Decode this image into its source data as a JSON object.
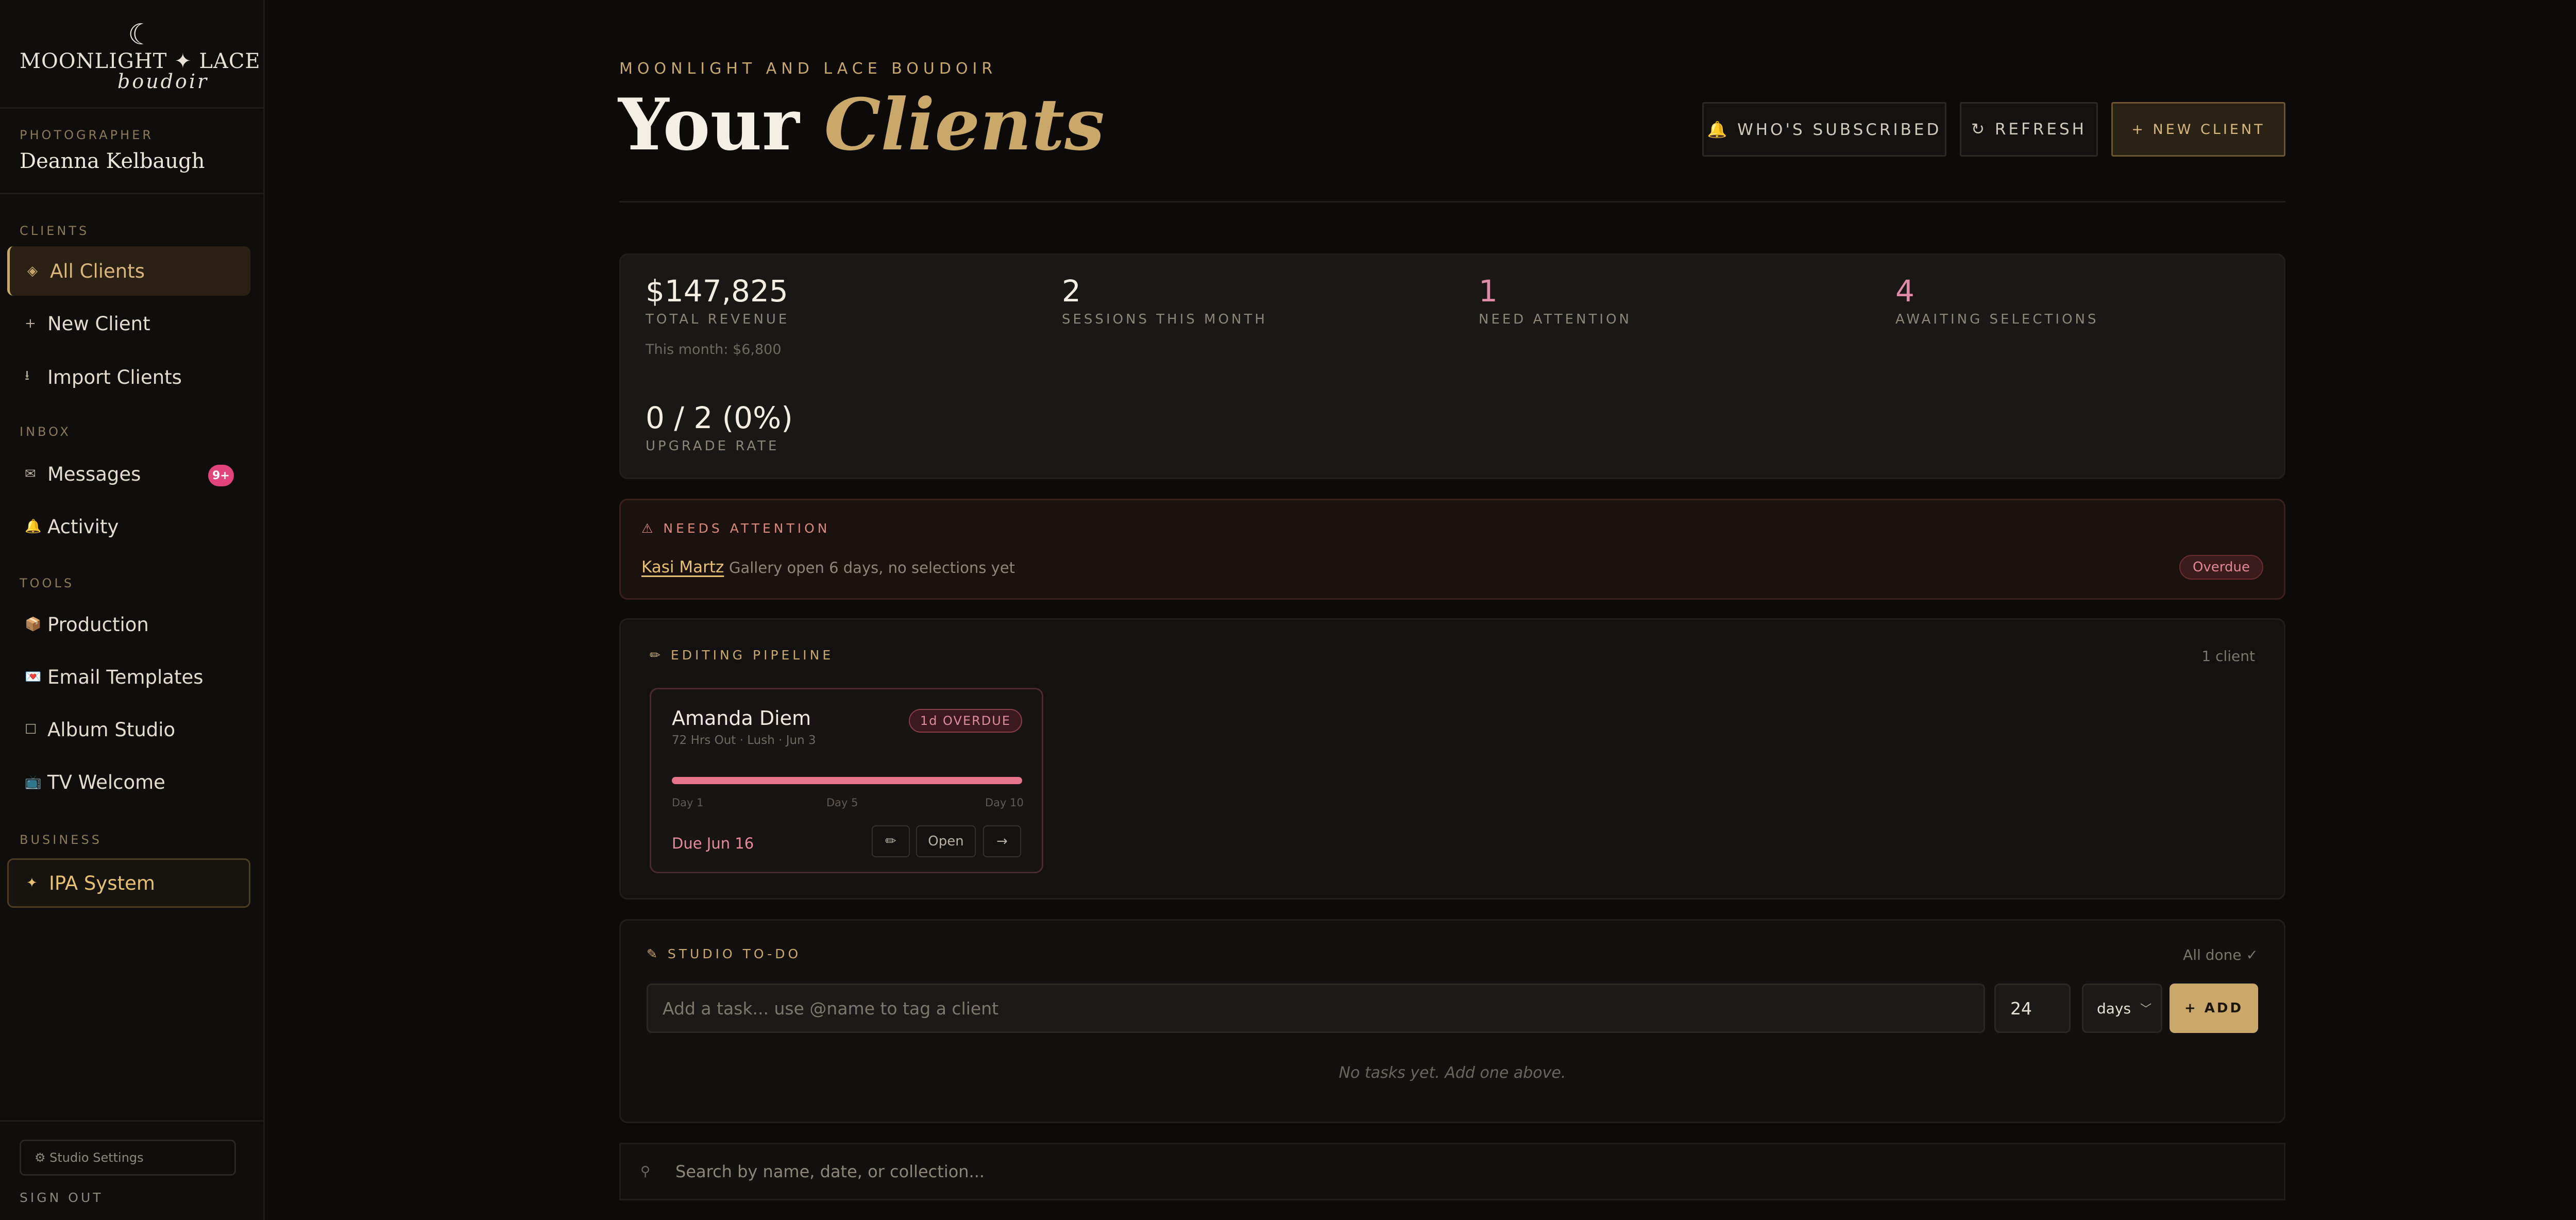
{
  "brand": {
    "logo_main": "MOONLIGHT ✦ LACE",
    "logo_script": "boudoir",
    "logo_moon": "☾"
  },
  "sidebar": {
    "photographer_label": "PHOTOGRAPHER",
    "photographer_name": "Deanna Kelbaugh",
    "clients_label": "CLIENTS",
    "inbox_label": "INBOX",
    "tools_label": "TOOLS",
    "business_label": "BUSINESS",
    "items": {
      "all_clients": {
        "label": "All Clients",
        "icon": "◈"
      },
      "new_client": {
        "label": "New Client",
        "icon": "+"
      },
      "import_clients": {
        "label": "Import Clients",
        "icon": "⭳"
      },
      "messages": {
        "label": "Messages",
        "icon": "✉",
        "badge": "9+"
      },
      "activity": {
        "label": "Activity",
        "icon": "🔔"
      },
      "production": {
        "label": "Production",
        "icon": "📦"
      },
      "email_templates": {
        "label": "Email Templates",
        "icon": "💌"
      },
      "album_studio": {
        "label": "Album Studio",
        "icon": "☐"
      },
      "tv_welcome": {
        "label": "TV Welcome",
        "icon": "📺"
      },
      "ipa_system": {
        "label": "IPA System",
        "icon": "✦"
      }
    },
    "studio_settings": "⚙ Studio Settings",
    "sign_out": "SIGN OUT"
  },
  "header": {
    "kicker": "MOONLIGHT AND LACE BOUDOIR",
    "title_plain": "Your ",
    "title_accent": "Clients",
    "btn_subscribed": "🔔 WHO'S SUBSCRIBED",
    "btn_refresh": "↻ REFRESH",
    "btn_new_client": "+ NEW CLIENT"
  },
  "stats": {
    "revenue": {
      "value": "$147,825",
      "label": "TOTAL REVENUE",
      "sub": "This month: $6,800"
    },
    "sessions": {
      "value": "2",
      "label": "SESSIONS THIS MONTH"
    },
    "attention": {
      "value": "1",
      "label": "NEED ATTENTION"
    },
    "selections": {
      "value": "4",
      "label": "AWAITING SELECTIONS"
    },
    "upgrade": {
      "value": "0 / 2 (0%)",
      "label": "UPGRADE RATE"
    }
  },
  "needs_attention": {
    "heading": "⚠ NEEDS ATTENTION",
    "client": "Kasi Martz",
    "description": "Gallery open 6 days, no selections yet",
    "status": "Overdue"
  },
  "pipeline": {
    "heading": "EDITING PIPELINE",
    "heading_icon": "✏",
    "count": "1 client",
    "card": {
      "name": "Amanda Diem",
      "meta": "72 Hrs Out · Lush · Jun 3",
      "status": "1d OVERDUE",
      "progress": 1.0,
      "ticks": [
        "Day 1",
        "Day 5",
        "Day 10"
      ],
      "due": "Due Jun 16",
      "btn_edit_icon": "✏",
      "btn_open": "Open",
      "btn_next": "→"
    }
  },
  "todo": {
    "heading": "✎ STUDIO TO-DO",
    "status": "All done ✓",
    "task_placeholder": "Add a task... use @name to tag a client",
    "days_value": "24",
    "unit_selected": "days",
    "add_label": "+ ADD",
    "empty": "No tasks yet. Add one above."
  },
  "search": {
    "icon": "⚲",
    "placeholder": "Search by name, date, or collection..."
  },
  "colors": {
    "gold": "#c9a86a",
    "pink": "#e08aa8",
    "background": "#0c0b0a",
    "badge": "#e0447a"
  }
}
